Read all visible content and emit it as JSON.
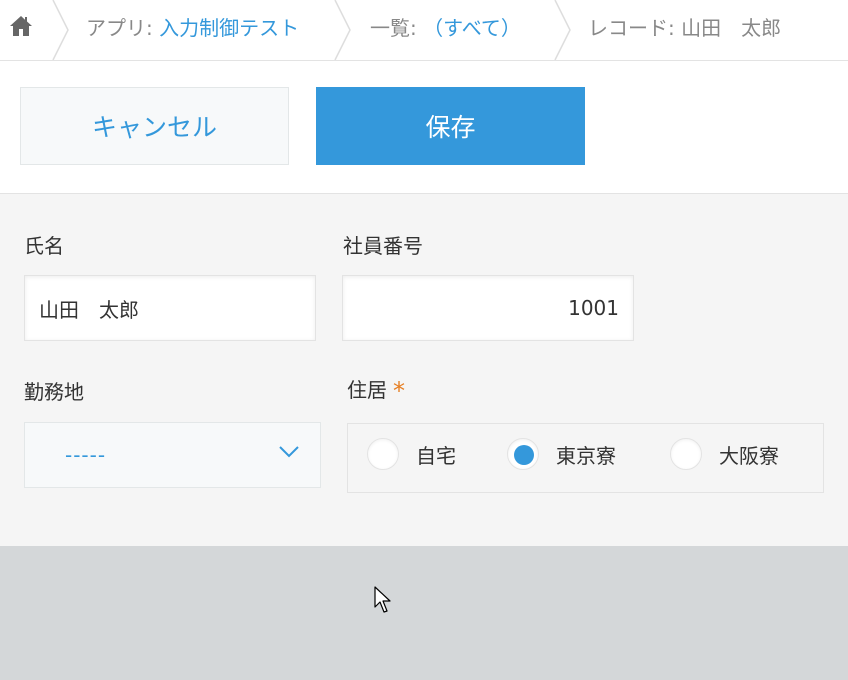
{
  "breadcrumb": {
    "home_icon": "home-icon",
    "app_prefix": "アプリ: ",
    "app_name": "入力制御テスト",
    "list_prefix": "一覧: ",
    "list_name": "（すべて）",
    "record": "レコード: 山田　太郎"
  },
  "toolbar": {
    "cancel_label": "キャンセル",
    "save_label": "保存"
  },
  "form": {
    "name": {
      "label": "氏名",
      "value": "山田　太郎"
    },
    "employee_no": {
      "label": "社員番号",
      "value": "1001"
    },
    "workplace": {
      "label": "勤務地",
      "value": "-----"
    },
    "residence": {
      "label": "住居",
      "required_mark": "*",
      "options": [
        {
          "label": "自宅",
          "selected": false
        },
        {
          "label": "東京寮",
          "selected": true
        },
        {
          "label": "大阪寮",
          "selected": false
        }
      ]
    }
  },
  "colors": {
    "accent": "#3498db",
    "required": "#e67e22",
    "form_bg": "#f5f5f5",
    "page_bg": "#d4d7d9"
  }
}
